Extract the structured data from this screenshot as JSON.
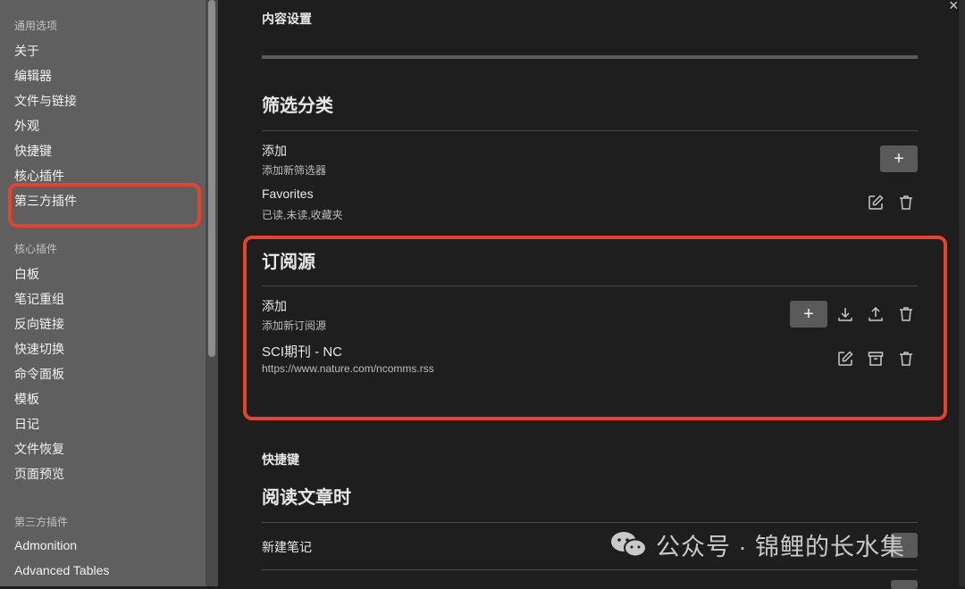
{
  "sidebar": {
    "sections": [
      {
        "heading": "通用选项",
        "items": [
          "关于",
          "编辑器",
          "文件与链接",
          "外观",
          "快捷键",
          "核心插件",
          "第三方插件"
        ]
      },
      {
        "heading": "核心插件",
        "items": [
          "白板",
          "笔记重组",
          "反向链接",
          "快速切换",
          "命令面板",
          "模板",
          "日记",
          "文件恢复",
          "页面预览"
        ]
      },
      {
        "heading": "第三方插件",
        "items": [
          "Admonition",
          "Advanced Tables"
        ]
      }
    ]
  },
  "main": {
    "content_settings": "内容设置",
    "filter_section": {
      "title": "筛选分类",
      "add_label": "添加",
      "add_desc": "添加新筛选器",
      "filter_name": "Favorites",
      "filter_desc": "已读,未读,收藏夹"
    },
    "feed_section": {
      "title": "订阅源",
      "add_label": "添加",
      "add_desc": "添加新订阅源",
      "feed_name": "SCI期刊 - NC",
      "feed_url": "https://www.nature.com/ncomms.rss"
    },
    "hotkeys_heading": "快捷键",
    "reading_title": "阅读文章时",
    "new_note_label": "新建笔记"
  },
  "buttons": {
    "plus": "+",
    "close": "×"
  },
  "watermark": {
    "text": "公众号 · 锦鲤的长水集"
  },
  "colors": {
    "highlight": "#e8412c",
    "sidebar_bg": "#5f5f5f",
    "main_bg": "#1e1e1e"
  }
}
